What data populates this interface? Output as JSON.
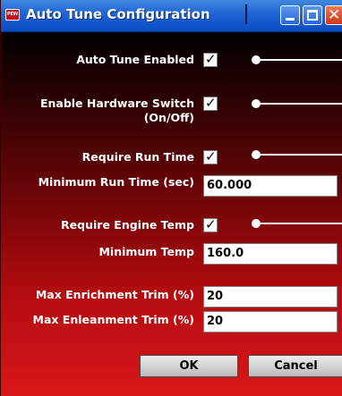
{
  "window": {
    "title": "Auto Tune Configuration",
    "app_icon_text": "PEW",
    "controls": {
      "minimize": "minimize-icon",
      "maximize": "maximize-icon",
      "close": "close-icon"
    }
  },
  "form": {
    "auto_tune_enabled": {
      "label": "Auto Tune Enabled",
      "checked": true
    },
    "hardware_switch": {
      "label_line1": "Enable Hardware Switch",
      "label_line2": "(On/Off)",
      "checked": true
    },
    "require_run_time": {
      "label": "Require Run Time",
      "checked": true
    },
    "min_run_time": {
      "label": "Minimum Run Time (sec)",
      "value": "60.000"
    },
    "require_engine_temp": {
      "label": "Require Engine Temp",
      "checked": true
    },
    "min_temp": {
      "label": "Minimum Temp",
      "value": "160.0"
    },
    "max_enrichment": {
      "label": "Max Enrichment Trim (%)",
      "value": "20"
    },
    "max_enleanment": {
      "label": "Max Enleanment Trim (%)",
      "value": "20"
    }
  },
  "buttons": {
    "ok": "OK",
    "cancel": "Cancel"
  },
  "checkmark": "✓",
  "colors": {
    "titlebar": "#1f63d3",
    "background_top": "#020000",
    "background_bottom": "#d9161a"
  }
}
